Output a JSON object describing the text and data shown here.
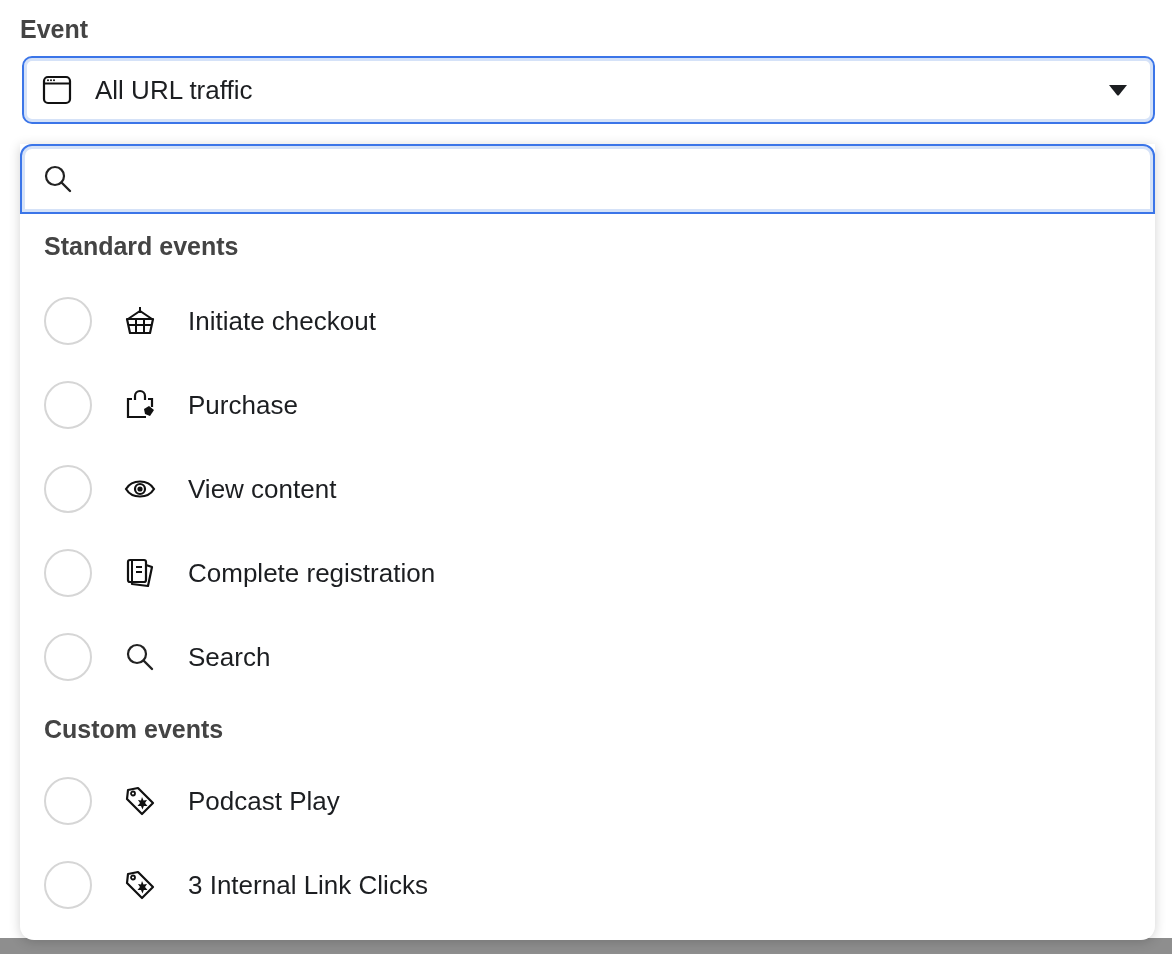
{
  "field_label": "Event",
  "select": {
    "value": "All URL traffic"
  },
  "groups": [
    {
      "heading": "Standard events",
      "items": [
        {
          "label": "Initiate checkout",
          "kind": "basket",
          "selected": false
        },
        {
          "label": "Purchase",
          "kind": "bag",
          "selected": false
        },
        {
          "label": "View content",
          "kind": "eye",
          "selected": false
        },
        {
          "label": "Complete registration",
          "kind": "registration",
          "selected": false
        },
        {
          "label": "Search",
          "kind": "search",
          "selected": false
        }
      ]
    },
    {
      "heading": "Custom events",
      "items": [
        {
          "label": "Podcast Play",
          "kind": "tag",
          "selected": false
        },
        {
          "label": "3 Internal Link Clicks",
          "kind": "tag",
          "selected": false
        }
      ]
    }
  ]
}
